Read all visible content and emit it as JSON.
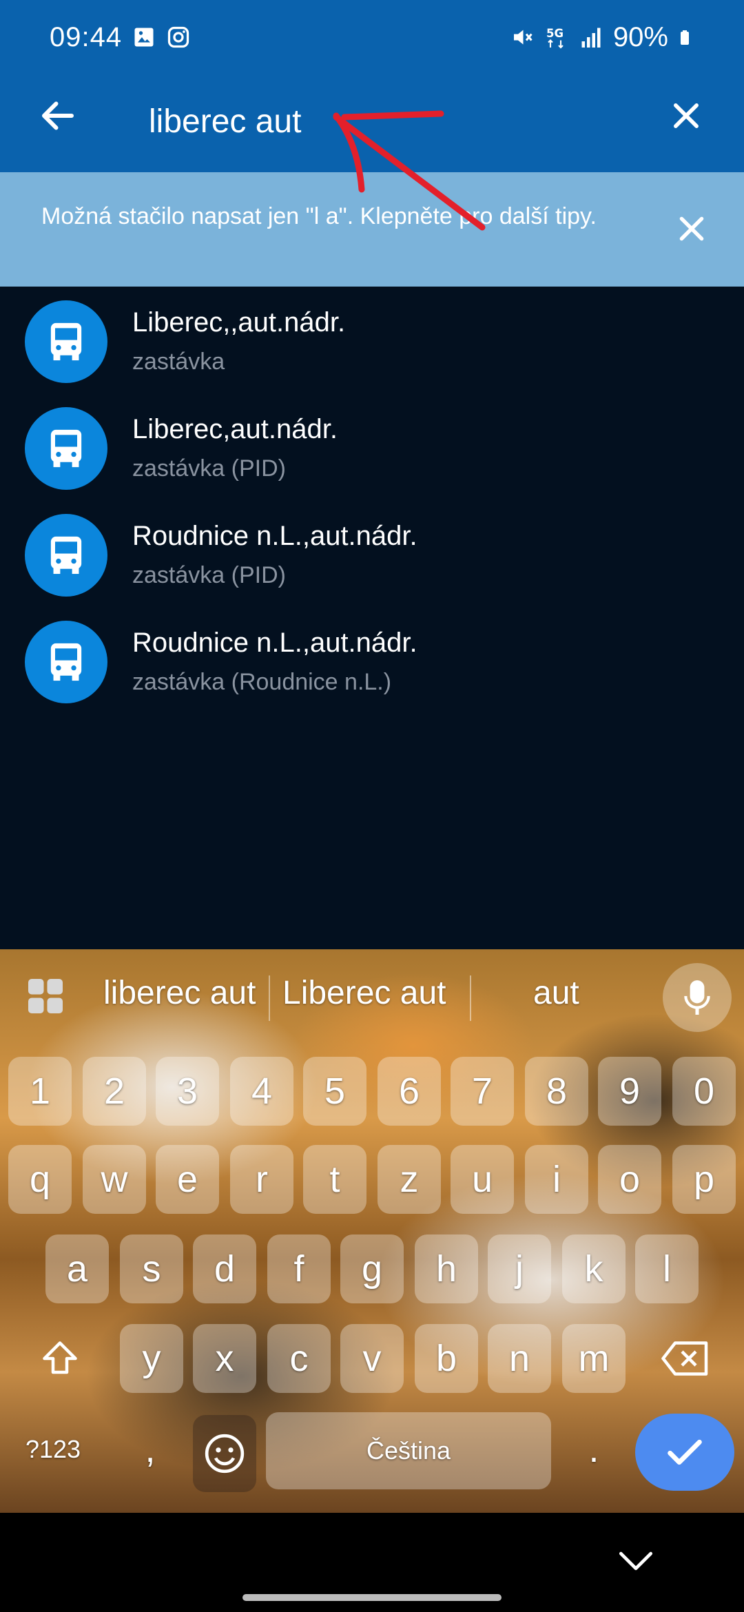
{
  "status_bar": {
    "time": "09:44",
    "battery": "90%",
    "icons": [
      "gallery-icon",
      "instagram-icon",
      "mute-icon",
      "5g-icon",
      "signal-icon",
      "battery-icon"
    ]
  },
  "search": {
    "query": "liberec aut"
  },
  "tip": {
    "text": "Možná stačilo napsat jen \"l a\". Klepněte pro další tipy."
  },
  "results": [
    {
      "title": "Liberec,,aut.nádr.",
      "subtitle": "zastávka",
      "icon": "bus-icon"
    },
    {
      "title": "Liberec,aut.nádr.",
      "subtitle": "zastávka (PID)",
      "icon": "bus-icon"
    },
    {
      "title": "Roudnice n.L.,aut.nádr.",
      "subtitle": "zastávka (PID)",
      "icon": "bus-icon"
    },
    {
      "title": "Roudnice n.L.,aut.nádr.",
      "subtitle": "zastávka (Roudnice n.L.)",
      "icon": "bus-icon"
    }
  ],
  "keyboard": {
    "suggestions": [
      "liberec aut",
      "Liberec aut",
      "aut"
    ],
    "row_numbers": [
      "1",
      "2",
      "3",
      "4",
      "5",
      "6",
      "7",
      "8",
      "9",
      "0"
    ],
    "row_top": [
      "q",
      "w",
      "e",
      "r",
      "t",
      "z",
      "u",
      "i",
      "o",
      "p"
    ],
    "row_middle": [
      "a",
      "s",
      "d",
      "f",
      "g",
      "h",
      "j",
      "k",
      "l"
    ],
    "row_bottom": [
      "y",
      "x",
      "c",
      "v",
      "b",
      "n",
      "m"
    ],
    "symbols_label": "?123",
    "comma": ",",
    "space_label": "Čeština",
    "period": "."
  },
  "colors": {
    "app_bar": "#0a62ad",
    "tip_banner": "#7bb3da",
    "background": "#03101f",
    "result_icon": "#0b86dc",
    "enter_key": "#4d8bf0",
    "annotation": "#e3202b"
  }
}
